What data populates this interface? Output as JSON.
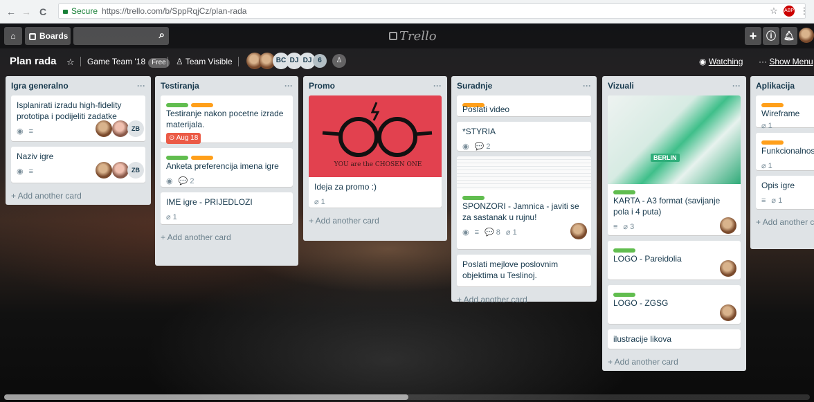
{
  "browser": {
    "secure_label": "Secure",
    "url": "https://trello.com/b/SppRqjCz/plan-rada",
    "back": "←",
    "forward": "→",
    "reload": "C",
    "ext_abp": "ABP"
  },
  "header": {
    "home_icon": "⌂",
    "boards_label": "Boards",
    "search_icon": "⌕",
    "logo_text": "Trello",
    "add_icon": "+",
    "info_icon": "ⓘ",
    "bell_icon": "♫"
  },
  "board": {
    "title": "Plan rada",
    "team": "Game Team '18",
    "free_badge": "Free",
    "visibility": "Team Visible",
    "members": [
      "BC",
      "DJ",
      "DJ",
      "6"
    ],
    "watching": "Watching",
    "show_menu": "Show Menu",
    "menu_dots": "···"
  },
  "lists": [
    {
      "name": "Igra generalno",
      "cards": [
        {
          "title": "Isplanirati izradu high-fidelity prototipa i podijeliti zadatke",
          "badges": [
            "◉",
            "≡"
          ],
          "avatars": [
            "photo",
            "photo",
            "ZB"
          ]
        },
        {
          "title": "Naziv igre",
          "badges": [
            "◉",
            "≡"
          ],
          "avatars": [
            "photo",
            "photo",
            "ZB"
          ]
        }
      ],
      "add": "+ Add another card"
    },
    {
      "name": "Testiranja",
      "cards": [
        {
          "title": "Testiranje nakon pocetne izrade materijala.",
          "labels": [
            "#61bd4f",
            "#ff9f1a"
          ],
          "due": "⊙ Aug 18"
        },
        {
          "title": "Anketa preferencija imena igre",
          "labels": [
            "#61bd4f",
            "#ff9f1a"
          ],
          "badges": [
            "◉",
            "💬 2"
          ]
        },
        {
          "title": "IME igre - PRIJEDLOZI",
          "badges": [
            "⌀ 1"
          ]
        }
      ],
      "add": "+ Add another card"
    },
    {
      "name": "Promo",
      "cards": [
        {
          "title": "Ideja za promo :)",
          "cover": "red-glasses",
          "cover_text": "YOU\nare the\nCHOSEN ONE",
          "badges": [
            "⌀ 1"
          ]
        }
      ],
      "add": "+ Add another card"
    },
    {
      "name": "Suradnje",
      "cards": [
        {
          "title": "Poslati video",
          "labels": [
            "#ff9f1a"
          ]
        },
        {
          "title": "*STYRIA",
          "badges": [
            "◉",
            "💬 2"
          ]
        },
        {
          "title": "SPONZORI - Jamnica - javiti se za sastanak u rujnu!",
          "cover": "document",
          "labels": [
            "#61bd4f"
          ],
          "badges": [
            "◉",
            "≡",
            "💬 8",
            "⌀ 1"
          ],
          "avatars": [
            "photo"
          ]
        },
        {
          "title": "Poslati mejlove poslovnim objektima u Teslinoj."
        }
      ],
      "add": "+ Add another card"
    },
    {
      "name": "Vizuali",
      "cards": [
        {
          "title": "KARTA - A3 format (savijanje pola i 4 puta)",
          "cover": "green-map",
          "cover_text": "BERLIN",
          "labels": [
            "#61bd4f"
          ],
          "badges": [
            "≡",
            "⌀ 3"
          ],
          "avatars": [
            "photo"
          ]
        },
        {
          "title": "LOGO - Pareidolia",
          "labels": [
            "#61bd4f"
          ],
          "avatars": [
            "photo"
          ]
        },
        {
          "title": "LOGO - ZGSG",
          "labels": [
            "#61bd4f"
          ],
          "avatars": [
            "photo"
          ]
        },
        {
          "title": "ilustracije likova"
        }
      ],
      "add": "+ Add another card"
    },
    {
      "name": "Aplikacija",
      "cards": [
        {
          "title": "Wireframe",
          "labels": [
            "#ff9f1a"
          ],
          "badges": [
            "⌀ 1"
          ]
        },
        {
          "title": "Funkcionalnosti a",
          "labels": [
            "#ff9f1a"
          ],
          "badges": [
            "⌀ 1"
          ]
        },
        {
          "title": "Opis igre",
          "badges": [
            "≡",
            "⌀ 1"
          ]
        }
      ],
      "add": "+ Add another ca"
    }
  ]
}
